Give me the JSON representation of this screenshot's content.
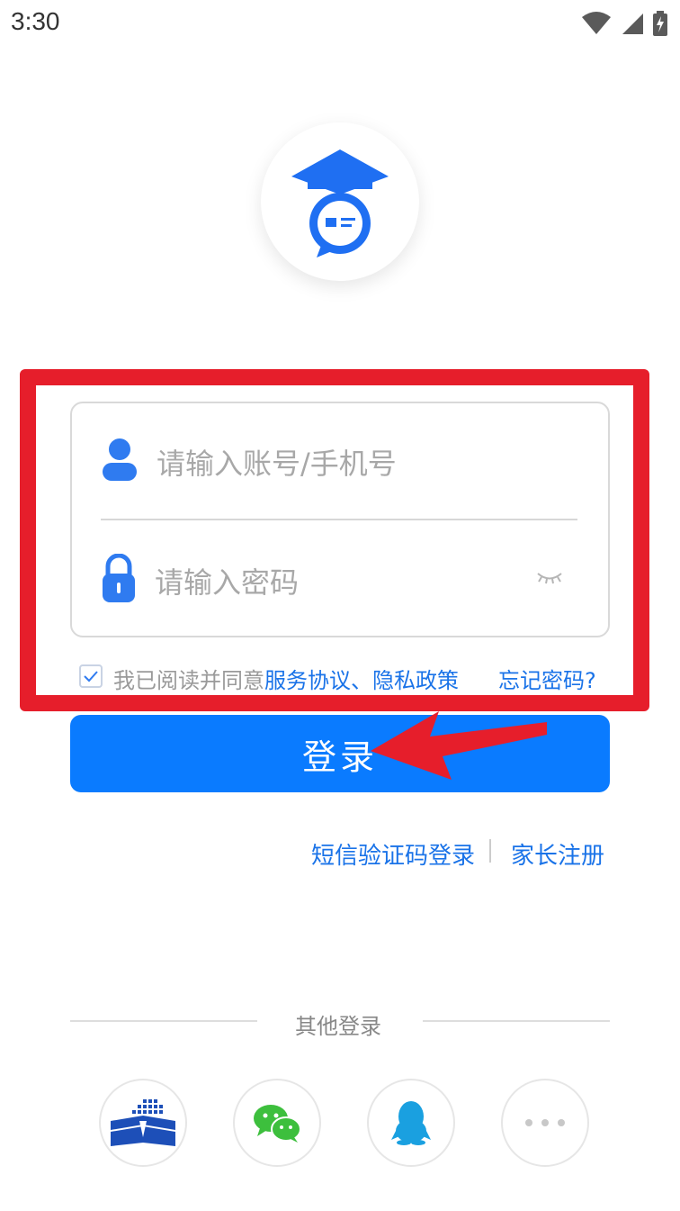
{
  "status_bar": {
    "time": "3:30"
  },
  "login_form": {
    "account_placeholder": "请输入账号/手机号",
    "password_placeholder": "请输入密码"
  },
  "agreement": {
    "prefix": "我已阅读并同意",
    "links": "服务协议、隐私政策",
    "checked": true
  },
  "forgot_password": "忘记密码?",
  "login_button": "登录",
  "secondary_links": {
    "sms_login": "短信验证码登录",
    "parent_register": "家长注册"
  },
  "other_login": {
    "title": "其他登录",
    "providers": [
      "education-platform-icon",
      "wechat-icon",
      "qq-icon",
      "more-icon"
    ]
  },
  "colors": {
    "accent": "#0a7bff",
    "link": "#1a73e8",
    "highlight": "#e61e2b"
  }
}
